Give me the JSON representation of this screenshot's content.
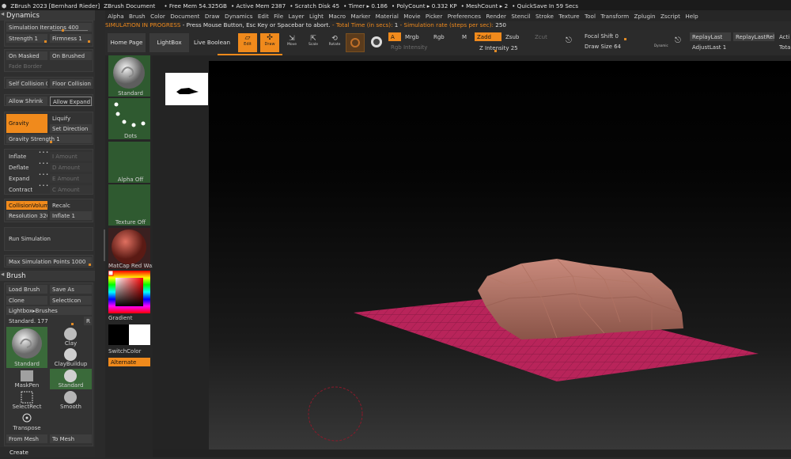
{
  "titlebar": {
    "app": "ZBrush 2023 [Bernhard Rieder]",
    "doc": "ZBrush Document",
    "free_mem": "• Free Mem 54.325GB",
    "active_mem": "• Active Mem 2387",
    "scratch": "• Scratch Disk 45",
    "timer": "• Timer ▸ 0.186",
    "polycount": "• PolyCount ▸ 0.332 KP",
    "meshcount": "• MeshCount ▸ 2",
    "quicksave": "• QuickSave In 59 Secs"
  },
  "menu": [
    "Alpha",
    "Brush",
    "Color",
    "Document",
    "Draw",
    "Dynamics",
    "Edit",
    "File",
    "Layer",
    "Light",
    "Macro",
    "Marker",
    "Material",
    "Movie",
    "Picker",
    "Preferences",
    "Render",
    "Stencil",
    "Stroke",
    "Texture",
    "Tool",
    "Transform",
    "Zplugin",
    "Zscript",
    "Help"
  ],
  "message": {
    "status": "SIMULATION IN PROGRESS",
    "prompt": "- Press Mouse Button, Esc Key or Spacebar to abort.",
    "total_label": "- Total Time (in secs):",
    "total_value": "1",
    "rate_label": "- Simulation rate (steps per sec):",
    "rate_value": "250"
  },
  "dynamics": {
    "title": "Dynamics",
    "sim_iterations": "Simulation Iterations 400",
    "strength": "Strength 1",
    "firmness": "Firmness 1",
    "on_masked": "On Masked",
    "on_brushed": "On Brushed",
    "fade_border": "Fade Border",
    "self_collision": "Self Collision 0",
    "floor_collision": "Floor Collision",
    "allow_shrink": "Allow Shrink",
    "allow_expand": "Allow Expand",
    "gravity": "Gravity",
    "liquify": "Liquify",
    "set_direction": "Set Direction",
    "gravity_strength": "Gravity Strength 1",
    "inflate": "Inflate",
    "deflate": "Deflate",
    "expand": "Expand",
    "contract": "Contract",
    "dots": "• • •",
    "i_amount": "I Amount",
    "d_amount": "D Amount",
    "e_amount": "E Amount",
    "c_amount": "C Amount",
    "collision_volume": "CollisionVolume",
    "recalc": "Recalc",
    "resolution": "Resolution 3200",
    "inflate1": "Inflate 1",
    "run_simulation": "Run Simulation",
    "max_points": "Max Simulation Points 1000"
  },
  "brush": {
    "title": "Brush",
    "load": "Load Brush",
    "save": "Save As",
    "clone": "Clone",
    "select_icon": "SelectIcon",
    "lightbox": "Lightbox▸Brushes",
    "current": "Standard. 177",
    "r": "R",
    "items": [
      "Standard",
      "Clay",
      "ClayBuildup",
      "MaskPen",
      "Standard",
      "SelectRect",
      "Smooth",
      "Transpose"
    ],
    "from_mesh": "From Mesh",
    "to_mesh": "To Mesh",
    "create": "Create"
  },
  "shelf": {
    "home": "Home Page",
    "lightbox": "LightBox",
    "live_boolean": "Live Boolean",
    "edit": "Edit",
    "draw": "Draw",
    "move": "Move",
    "scale": "Scale",
    "rotate": "Rotate",
    "a": "A",
    "mrgb": "Mrgb",
    "rgb": "Rgb",
    "m": "M",
    "zadd": "Zadd",
    "zsub": "Zsub",
    "zcut": "Zcut",
    "rgb_intensity": "Rgb Intensity",
    "z_intensity": "Z Intensity 25",
    "focal_shift": "Focal Shift 0",
    "draw_size": "Draw Size 64",
    "dynamic": "Dynamic",
    "replay_last": "ReplayLast",
    "replay_last_rel": "ReplayLastRel",
    "adjust_last": "AdjustLast 1",
    "acti": "Acti",
    "total": "Total"
  },
  "left_shelf": {
    "standard": "Standard",
    "dots": "Dots",
    "alpha_off": "Alpha Off",
    "texture_off": "Texture Off",
    "matcap": "MatCap Red Wax",
    "gradient": "Gradient",
    "switch_color": "SwitchColor",
    "alternate": "Alternate"
  },
  "colors": {
    "accent": "#f08a1c",
    "mesh": "#a86a5e",
    "floor": "#b8245a"
  }
}
